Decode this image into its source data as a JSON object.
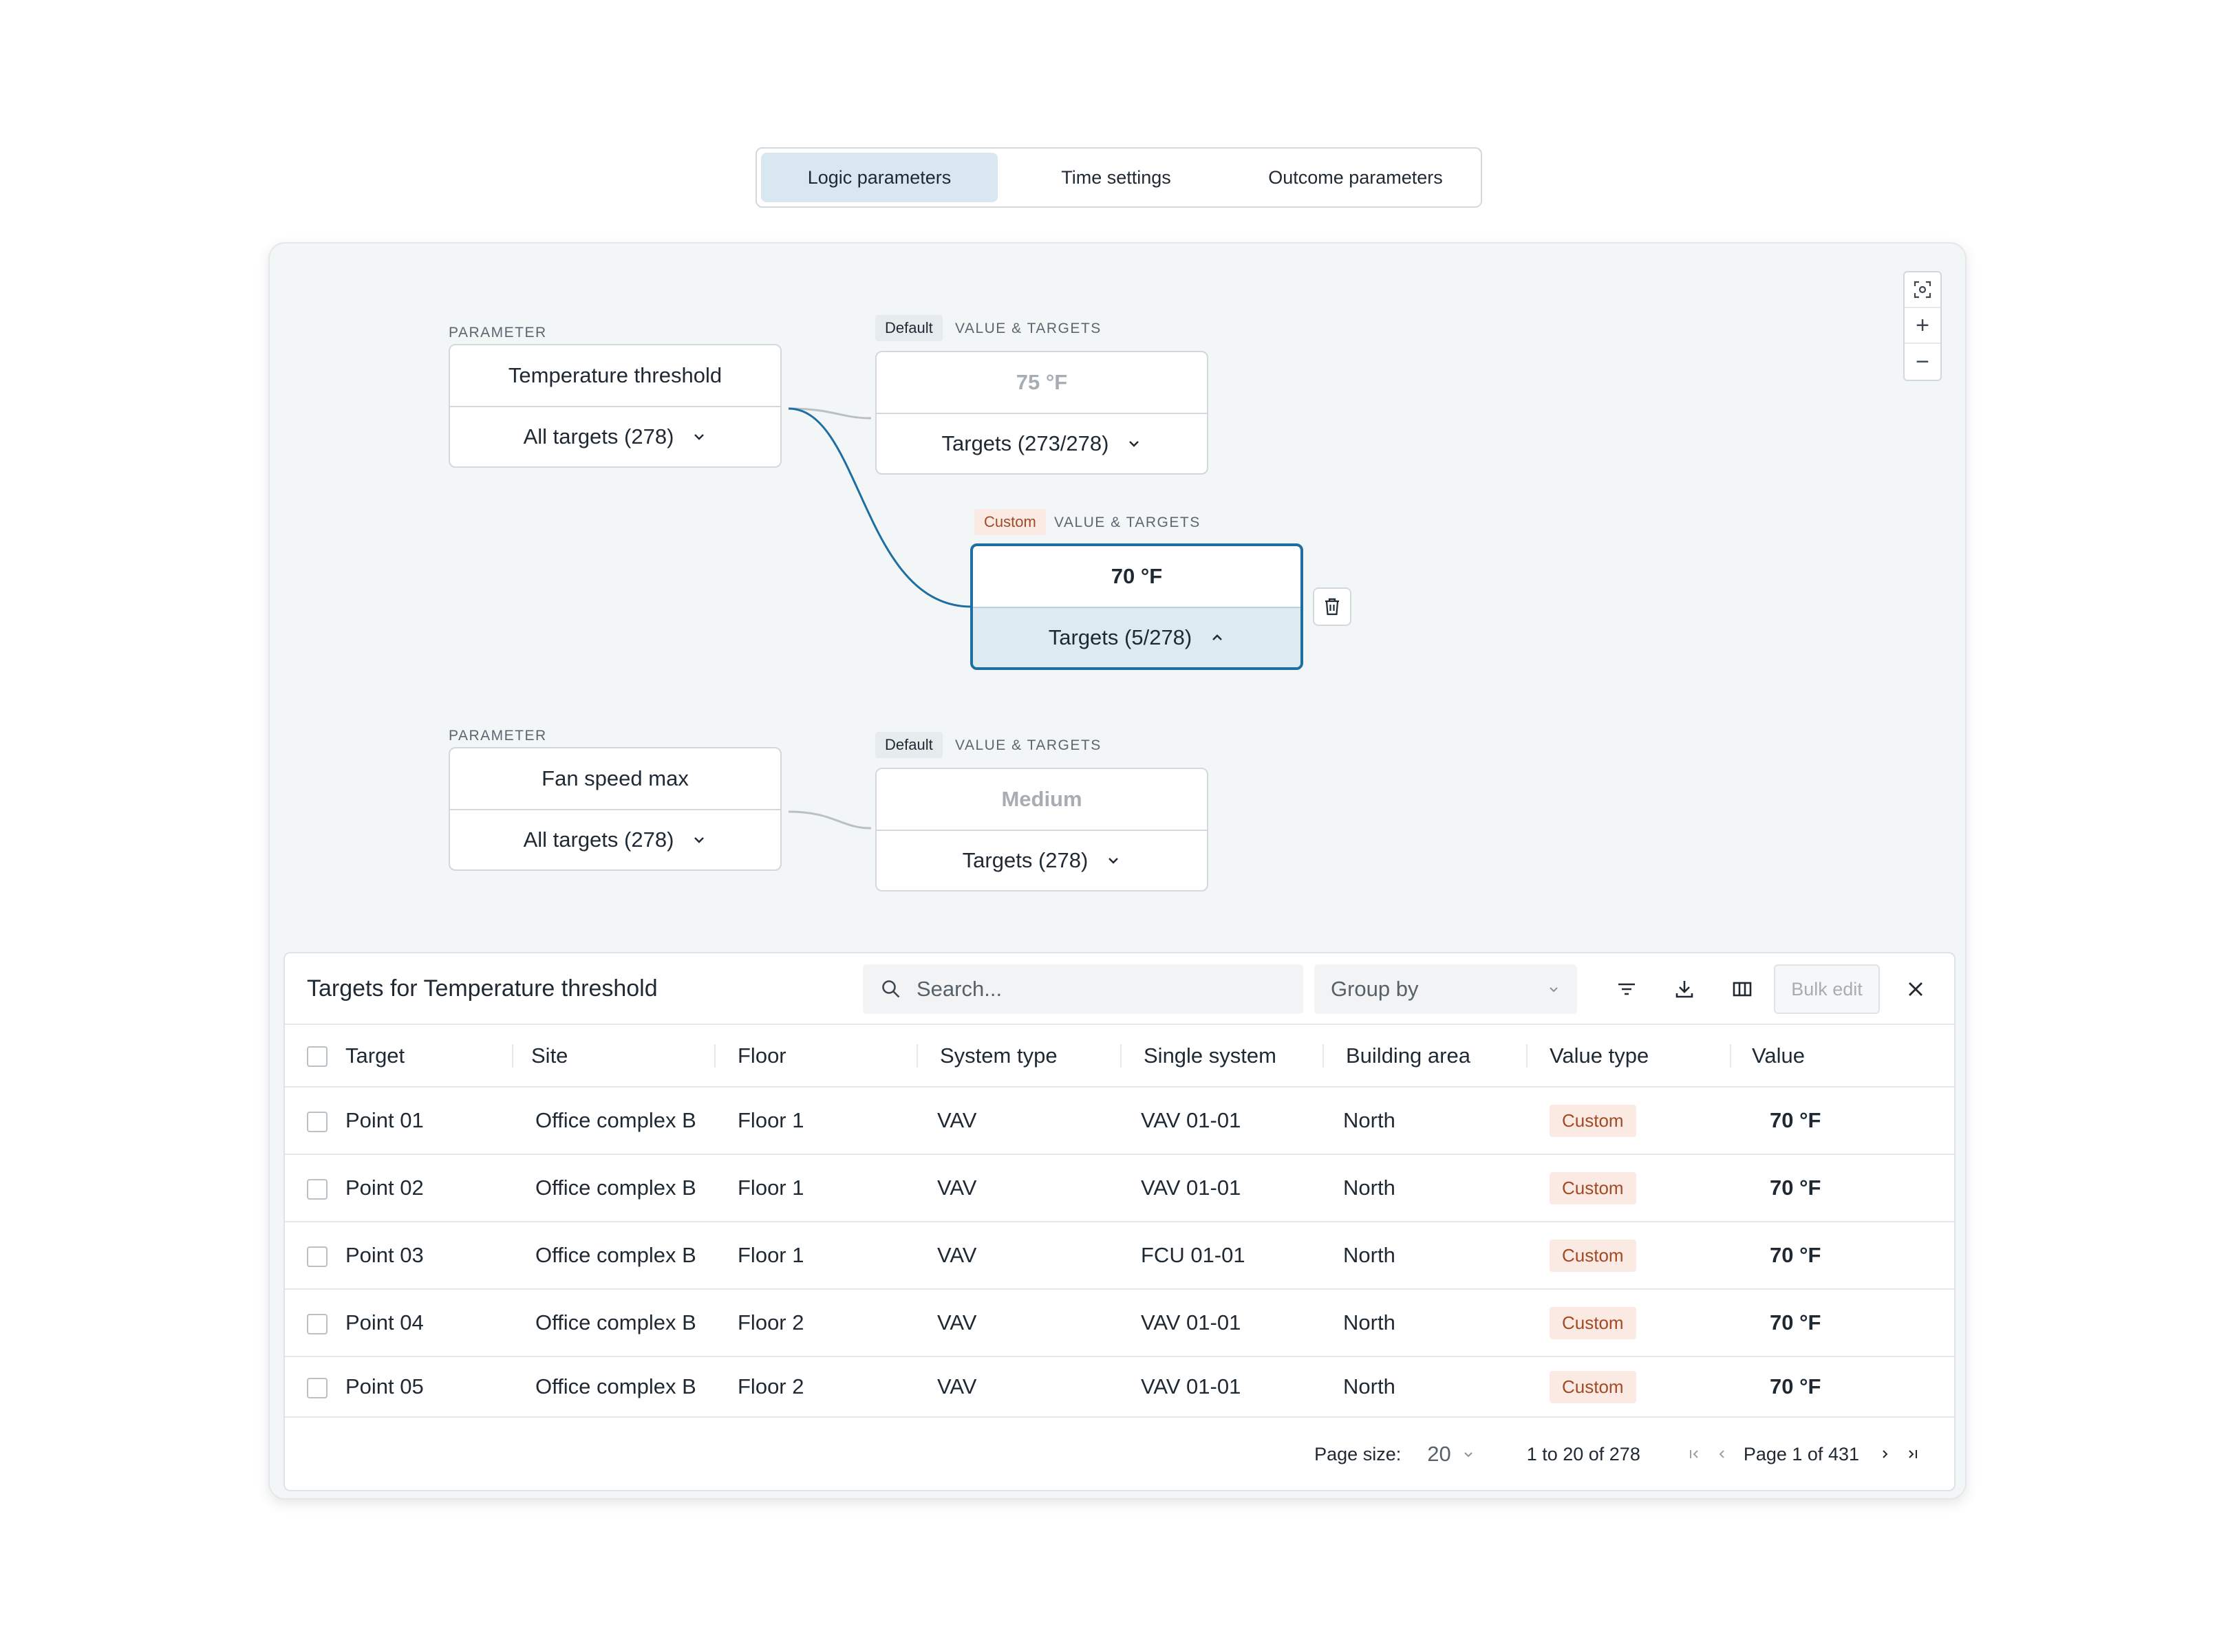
{
  "tabs": [
    {
      "label": "Logic parameters",
      "active": true
    },
    {
      "label": "Time settings",
      "active": false
    },
    {
      "label": "Outcome parameters",
      "active": false
    }
  ],
  "canvas": {
    "param1": {
      "label": "PARAMETER",
      "name": "Temperature threshold",
      "targets": "All targets (278)",
      "default_tag": "Default",
      "default_section": "VALUE & TARGETS",
      "default_value": "75 °F",
      "default_targets": "Targets (273/278)",
      "custom_tag": "Custom",
      "custom_section": "VALUE & TARGETS",
      "custom_value": "70 °F",
      "custom_targets": "Targets (5/278)"
    },
    "param2": {
      "label": "PARAMETER",
      "name": "Fan speed max",
      "targets": "All targets (278)",
      "default_tag": "Default",
      "default_section": "VALUE & TARGETS",
      "default_value": "Medium",
      "default_targets": "Targets (278)"
    },
    "zoom_controls": [
      "fit-view-icon",
      "zoom-in-icon",
      "zoom-out-icon"
    ],
    "edge_color_selected": "#1c6fa0",
    "edge_color": "#b9c0c6"
  },
  "table_panel": {
    "title": "Targets for Temperature threshold",
    "search_placeholder": "Search...",
    "group_by": "Group by",
    "bulk_edit": "Bulk edit",
    "columns": [
      "Target",
      "Site",
      "Floor",
      "System type",
      "Single system",
      "Building area",
      "Value type",
      "Value"
    ],
    "rows": [
      {
        "target": "Point 01",
        "site": "Office complex B",
        "floor": "Floor 1",
        "system_type": "VAV",
        "single_system": "VAV 01-01",
        "area": "North",
        "value_type": "Custom",
        "value": "70 °F"
      },
      {
        "target": "Point 02",
        "site": "Office complex B",
        "floor": "Floor 1",
        "system_type": "VAV",
        "single_system": "VAV 01-01",
        "area": "North",
        "value_type": "Custom",
        "value": "70 °F"
      },
      {
        "target": "Point 03",
        "site": "Office complex B",
        "floor": "Floor 1",
        "system_type": "VAV",
        "single_system": "FCU 01-01",
        "area": "North",
        "value_type": "Custom",
        "value": "70 °F"
      },
      {
        "target": "Point 04",
        "site": "Office complex B",
        "floor": "Floor 2",
        "system_type": "VAV",
        "single_system": "VAV 01-01",
        "area": "North",
        "value_type": "Custom",
        "value": "70 °F"
      },
      {
        "target": "Point 05",
        "site": "Office complex B",
        "floor": "Floor 2",
        "system_type": "VAV",
        "single_system": "VAV 01-01",
        "area": "North",
        "value_type": "Custom",
        "value": "70 °F"
      }
    ],
    "footer": {
      "page_size_label": "Page size:",
      "page_size": "20",
      "range": "1 to 20 of 278",
      "page": "Page 1 of 431"
    }
  },
  "colors": {
    "accent": "#1c6fa0",
    "active_tab": "#d9e8f0",
    "custom_badge_bg": "#fbeae3",
    "custom_badge_text": "#a24a24"
  }
}
